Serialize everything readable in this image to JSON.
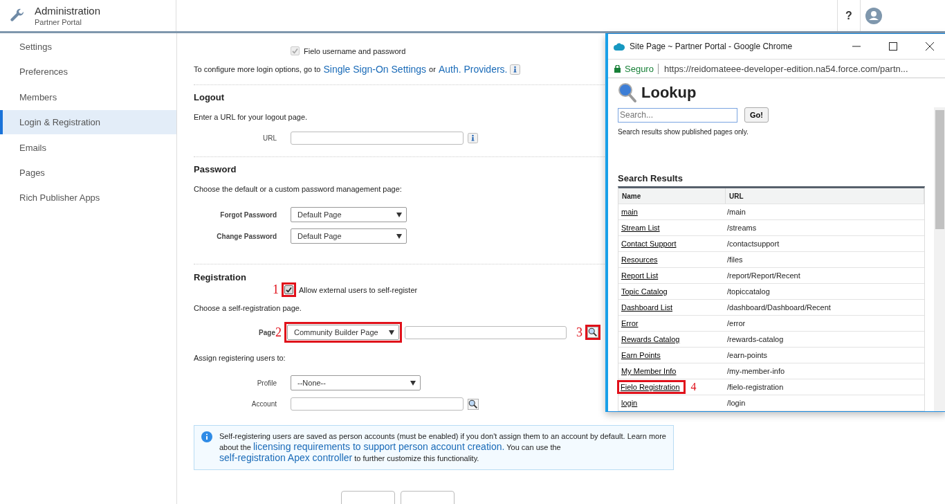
{
  "header": {
    "title": "Administration",
    "subtitle": "Partner Portal",
    "help": "?"
  },
  "sidebar": {
    "items": [
      {
        "label": "Settings",
        "selected": false
      },
      {
        "label": "Preferences",
        "selected": false
      },
      {
        "label": "Members",
        "selected": false
      },
      {
        "label": "Login & Registration",
        "selected": true
      },
      {
        "label": "Emails",
        "selected": false
      },
      {
        "label": "Pages",
        "selected": false
      },
      {
        "label": "Rich Publisher Apps",
        "selected": false
      }
    ]
  },
  "login": {
    "checkbox": {
      "label": "Fielo username and password",
      "checked": true,
      "disabled": true
    },
    "text": "To configure more login options, go to",
    "link1": "Single Sign-On Settings",
    "or": "or",
    "link2": "Auth. Providers."
  },
  "logout": {
    "title": "Logout",
    "text": "Enter a URL for your logout page.",
    "field_label": "URL"
  },
  "password": {
    "title": "Password",
    "text": "Choose the default or a custom password management page:",
    "fields": [
      {
        "label": "Forgot Password",
        "value": "Default Page"
      },
      {
        "label": "Change Password",
        "value": "Default Page"
      }
    ]
  },
  "registration": {
    "title": "Registration",
    "checkbox": {
      "label": "Allow external users to self-register",
      "checked": true,
      "annotation": "1"
    },
    "text": "Choose a self-registration page.",
    "page_label": "Page",
    "page_value": "Community Builder Page",
    "page_annotation": "2",
    "lookup_annotation": "3",
    "assign_text": "Assign registering users to:",
    "profile_label": "Profile",
    "profile_value": "--None--",
    "account_label": "Account"
  },
  "info": {
    "text1": "Self-registering users are saved as person accounts (must be enabled) if you don't assign them to an account by default. Learn more about the",
    "link1": "licensing requirements to support person account creation.",
    "text2": "You can use the",
    "link2": "self-registration Apex controller",
    "text3": "to further customize this functionality."
  },
  "popup": {
    "title": "Site Page ~ Partner Portal - Google Chrome",
    "secure": "Seguro",
    "url": "https://reidomateee-developer-edition.na54.force.com/partn...",
    "heading": "Lookup",
    "search_placeholder": "Search...",
    "go": "Go!",
    "note": "Search results show published pages only.",
    "results_title": "Search Results",
    "columns": [
      "Name",
      "URL"
    ],
    "rows": [
      {
        "name": "main",
        "url": "/main"
      },
      {
        "name": "Stream List",
        "url": "/streams"
      },
      {
        "name": "Contact Support",
        "url": "/contactsupport"
      },
      {
        "name": "Resources",
        "url": "/files"
      },
      {
        "name": "Report List",
        "url": "/report/Report/Recent"
      },
      {
        "name": "Topic Catalog",
        "url": "/topiccatalog"
      },
      {
        "name": "Dashboard List",
        "url": "/dashboard/Dashboard/Recent"
      },
      {
        "name": "Error",
        "url": "/error"
      },
      {
        "name": "Rewards Catalog",
        "url": "/rewards-catalog"
      },
      {
        "name": "Earn Points",
        "url": "/earn-points"
      },
      {
        "name": "My Member Info",
        "url": "/my-member-info"
      },
      {
        "name": "Fielo Registration",
        "url": "/fielo-registration",
        "annotation": "4"
      },
      {
        "name": "login",
        "url": "/login"
      }
    ]
  }
}
